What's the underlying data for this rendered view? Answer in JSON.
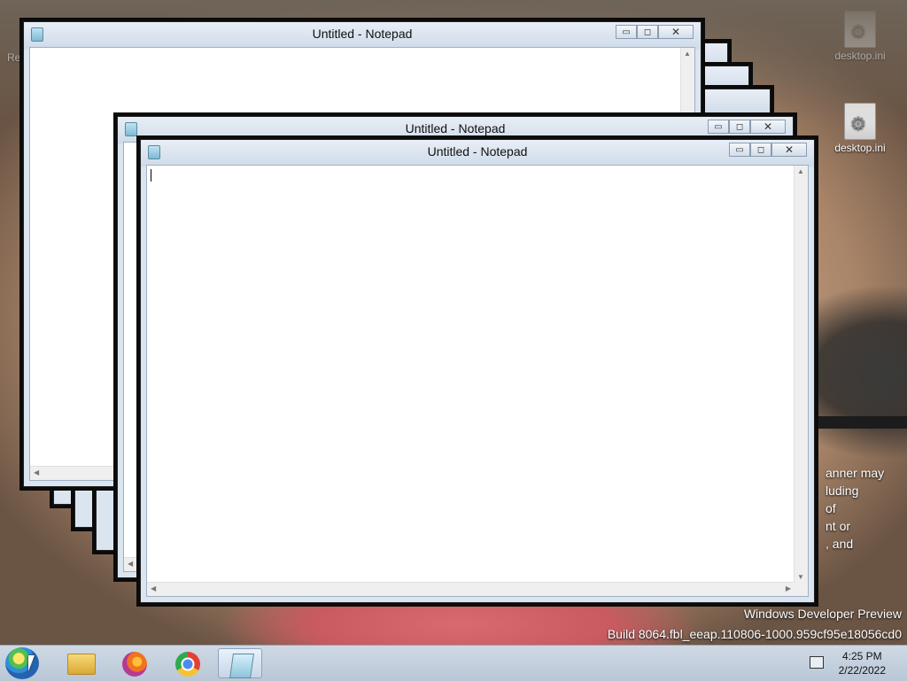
{
  "desktop": {
    "icons": [
      {
        "label": "desktop.ini",
        "icon": "settings-file-icon"
      },
      {
        "label": "desktop.ini",
        "icon": "settings-file-icon"
      }
    ],
    "partial_icon_label": "Re",
    "background_text": [
      "anner may",
      "luding",
      "of",
      "nt or",
      ", and"
    ],
    "watermark_line1": "Windows Developer Preview",
    "watermark_line2": "Build 8064.fbl_eeap.110806-1000.959cf95e18056cd0"
  },
  "windows": {
    "back": {
      "title": "Untitled - Notepad"
    },
    "middle": {
      "title": "Untitled - Notepad"
    },
    "front": {
      "title": "Untitled - Notepad"
    }
  },
  "caption": {
    "minimize": "▭",
    "maximize": "◻",
    "close": "✕"
  },
  "taskbar": {
    "apps": [
      {
        "name": "File Explorer",
        "icon": "folder-icon"
      },
      {
        "name": "Firefox",
        "icon": "firefox-icon"
      },
      {
        "name": "Chrome",
        "icon": "chrome-icon"
      },
      {
        "name": "Notepad",
        "icon": "notepad-icon",
        "active": true
      }
    ],
    "clock_time": "4:25 PM",
    "clock_date": "2/22/2022"
  }
}
